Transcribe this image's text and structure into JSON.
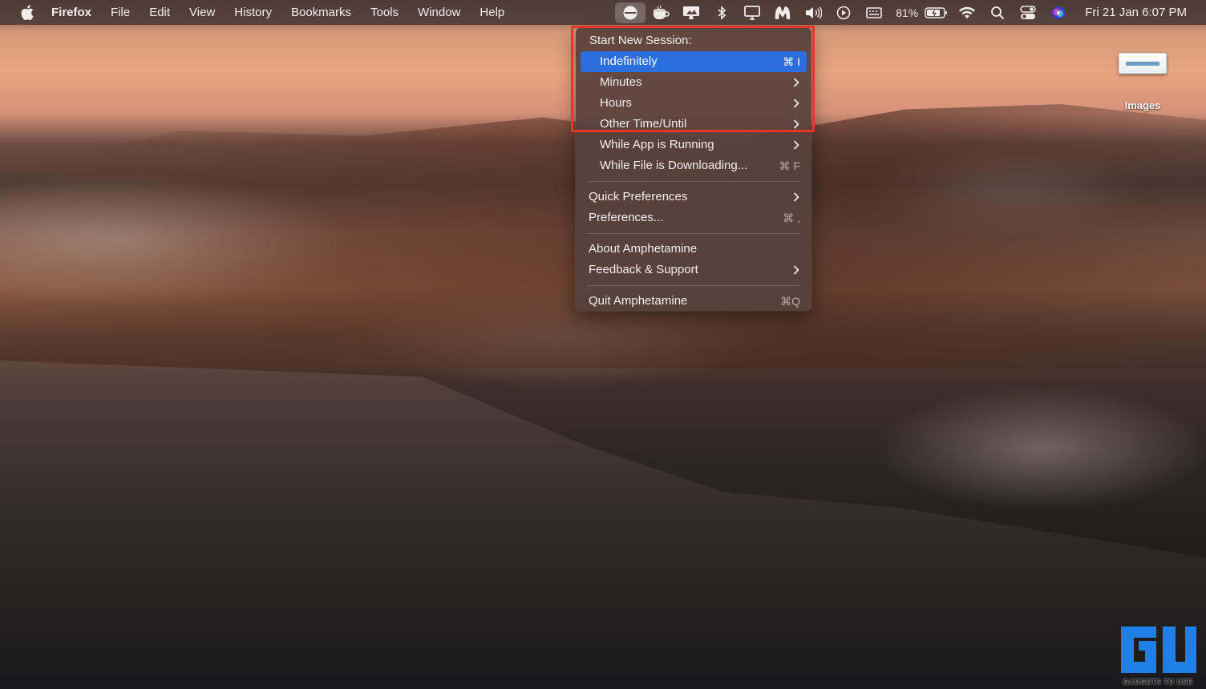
{
  "menubar": {
    "app_name": "Firefox",
    "menus": [
      "File",
      "Edit",
      "View",
      "History",
      "Bookmarks",
      "Tools",
      "Window",
      "Help"
    ],
    "status": {
      "battery_percent": "81%",
      "clock": "Fri 21 Jan  6:07 PM"
    },
    "icons": [
      "amphetamine-pill-icon",
      "caffeine-cup-icon",
      "display-icon",
      "bluetooth-icon",
      "screen-mirroring-icon",
      "malwarebytes-icon",
      "volume-icon",
      "play-icon",
      "keyboard-icon",
      "battery-icon",
      "wifi-icon",
      "spotlight-search-icon",
      "control-center-icon",
      "siri-icon"
    ]
  },
  "dropdown": {
    "header": "Start New Session:",
    "items": [
      {
        "label": "Indefinitely",
        "shortcut": "⌘ I",
        "selected": true
      },
      {
        "label": "Minutes",
        "submenu": true
      },
      {
        "label": "Hours",
        "submenu": true
      },
      {
        "label": "Other Time/Until",
        "submenu": true
      },
      {
        "label": "While App is Running",
        "submenu": true
      },
      {
        "label": "While File is Downloading...",
        "shortcut": "⌘ F"
      }
    ],
    "group2": [
      {
        "label": "Quick Preferences",
        "submenu": true
      },
      {
        "label": "Preferences...",
        "shortcut": "⌘ ,"
      }
    ],
    "group3": [
      {
        "label": "About Amphetamine"
      },
      {
        "label": "Feedback & Support",
        "submenu": true
      }
    ],
    "group4": [
      {
        "label": "Quit Amphetamine",
        "shortcut": "⌘Q"
      }
    ]
  },
  "desktop": {
    "items": [
      {
        "label": "Images"
      }
    ]
  },
  "watermark": {
    "caption": "GADGETS TO USE"
  },
  "colors": {
    "selection": "#2a6ee0",
    "highlight_box": "#e2372a",
    "watermark": "#1f7fe8"
  }
}
